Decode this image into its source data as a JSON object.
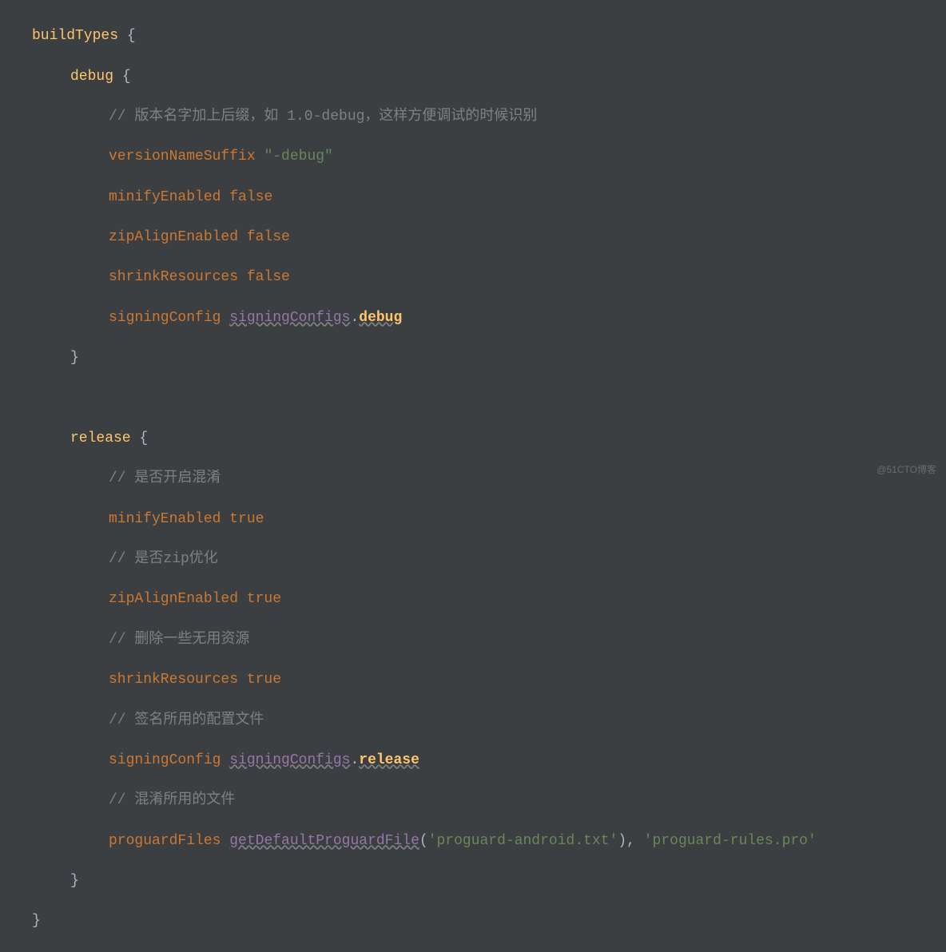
{
  "watermark": "@51CTO博客",
  "code": {
    "l1_buildTypes": "buildTypes",
    "l1_brace": " {",
    "l2_debug": "debug",
    "l2_brace": " {",
    "l3_comment": "// 版本名字加上后缀，如 1.0-debug，这样方便调试的时候识别",
    "l4_key": "versionNameSuffix ",
    "l4_val": "\"-debug\"",
    "l5_key": "minifyEnabled ",
    "l5_val": "false",
    "l6_key": "zipAlignEnabled ",
    "l6_val": "false",
    "l7_key": "shrinkResources ",
    "l7_val": "false",
    "l8_key": "signingConfig ",
    "l8_ref": "signingConfigs",
    "l8_dot": ".",
    "l8_member": "debug",
    "l9_brace": "}",
    "l11_release": "release",
    "l11_brace": " {",
    "l12_comment": "// 是否开启混淆",
    "l13_key": "minifyEnabled ",
    "l13_val": "true",
    "l14_comment": "// 是否zip优化",
    "l15_key": "zipAlignEnabled ",
    "l15_val": "true",
    "l16_comment": "// 删除一些无用资源",
    "l17_key": "shrinkResources ",
    "l17_val": "true",
    "l18_comment": "// 签名所用的配置文件",
    "l19_key": "signingConfig ",
    "l19_ref": "signingConfigs",
    "l19_dot": ".",
    "l19_member": "release",
    "l20_comment": "// 混淆所用的文件",
    "l21_key": "proguardFiles ",
    "l21_func": "getDefaultProguardFile",
    "l21_open": "(",
    "l21_arg1": "'proguard-android.txt'",
    "l21_close": ")",
    "l21_comma": ", ",
    "l21_arg2": "'proguard-rules.pro'",
    "l22_brace": "}",
    "l23_brace": "}"
  }
}
